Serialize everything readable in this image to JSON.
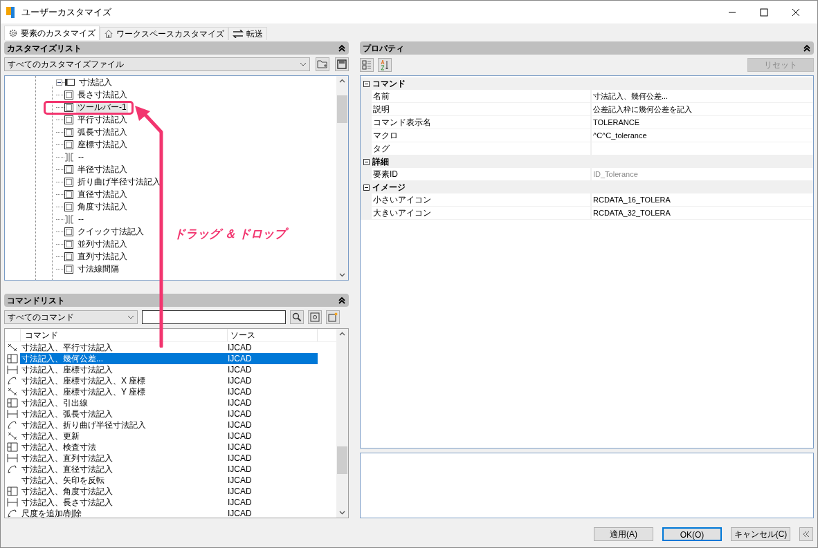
{
  "window": {
    "title": "ユーザーカスタマイズ"
  },
  "tabs": [
    {
      "label": "要素のカスタマイズ",
      "selected": true
    },
    {
      "label": "ワークスペースカスタマイズ",
      "selected": false
    },
    {
      "label": "転送",
      "selected": false
    }
  ],
  "customize_list": {
    "title": "カスタマイズリスト",
    "file_select": "すべてのカスタマイズファイル",
    "tree": [
      {
        "label": "寸法記入",
        "kind": "toolbar",
        "expanded": true,
        "children": [
          {
            "label": "長さ寸法記入",
            "kind": "command",
            "selected": false
          },
          {
            "label": "ツールバー-1",
            "kind": "command",
            "selected": true
          },
          {
            "label": "平行寸法記入",
            "kind": "command",
            "selected": false
          },
          {
            "label": "弧長寸法記入",
            "kind": "command",
            "selected": false
          },
          {
            "label": "座標寸法記入",
            "kind": "command",
            "selected": false
          },
          {
            "label": "--",
            "kind": "separator",
            "selected": false
          },
          {
            "label": "半径寸法記入",
            "kind": "command",
            "selected": false
          },
          {
            "label": "折り曲げ半径寸法記入",
            "kind": "command",
            "selected": false
          },
          {
            "label": "直径寸法記入",
            "kind": "command",
            "selected": false
          },
          {
            "label": "角度寸法記入",
            "kind": "command",
            "selected": false
          },
          {
            "label": "--",
            "kind": "separator",
            "selected": false
          },
          {
            "label": "クイック寸法記入",
            "kind": "command",
            "selected": false
          },
          {
            "label": "並列寸法記入",
            "kind": "command",
            "selected": false
          },
          {
            "label": "直列寸法記入",
            "kind": "command",
            "selected": false
          },
          {
            "label": "寸法線間隔",
            "kind": "command",
            "selected": false
          }
        ]
      }
    ]
  },
  "command_list": {
    "title": "コマンドリスト",
    "filter": "すべてのコマンド",
    "columns": [
      "コマンド",
      "ソース"
    ],
    "rows": [
      {
        "command": "寸法記入、平行寸法記入",
        "source": "IJCAD",
        "icon": true,
        "selected": false
      },
      {
        "command": "寸法記入、幾何公差...",
        "source": "IJCAD",
        "icon": true,
        "selected": true
      },
      {
        "command": "寸法記入、座標寸法記入",
        "source": "IJCAD",
        "icon": true,
        "selected": false
      },
      {
        "command": "寸法記入、座標寸法記入、X 座標",
        "source": "IJCAD",
        "icon": true,
        "selected": false
      },
      {
        "command": "寸法記入、座標寸法記入、Y 座標",
        "source": "IJCAD",
        "icon": true,
        "selected": false
      },
      {
        "command": "寸法記入、引出線",
        "source": "IJCAD",
        "icon": true,
        "selected": false
      },
      {
        "command": "寸法記入、弧長寸法記入",
        "source": "IJCAD",
        "icon": true,
        "selected": false
      },
      {
        "command": "寸法記入、折り曲げ半径寸法記入",
        "source": "IJCAD",
        "icon": true,
        "selected": false
      },
      {
        "command": "寸法記入、更新",
        "source": "IJCAD",
        "icon": true,
        "selected": false
      },
      {
        "command": "寸法記入、検査寸法",
        "source": "IJCAD",
        "icon": true,
        "selected": false
      },
      {
        "command": "寸法記入、直列寸法記入",
        "source": "IJCAD",
        "icon": true,
        "selected": false
      },
      {
        "command": "寸法記入、直径寸法記入",
        "source": "IJCAD",
        "icon": true,
        "selected": false
      },
      {
        "command": "寸法記入、矢印を反転",
        "source": "IJCAD",
        "icon": false,
        "selected": false
      },
      {
        "command": "寸法記入、角度寸法記入",
        "source": "IJCAD",
        "icon": true,
        "selected": false
      },
      {
        "command": "寸法記入、長さ寸法記入",
        "source": "IJCAD",
        "icon": true,
        "selected": false
      },
      {
        "command": "尺度を追加/削除",
        "source": "IJCAD",
        "icon": true,
        "selected": false
      }
    ]
  },
  "properties": {
    "title": "プロパティ",
    "reset": "リセット",
    "groups": [
      {
        "name": "コマンド",
        "expanded": true,
        "rows": [
          {
            "label": "名前",
            "value": "寸法記入、幾何公差...",
            "disabled": false
          },
          {
            "label": "説明",
            "value": "公差記入枠に幾何公差を記入",
            "disabled": false
          },
          {
            "label": "コマンド表示名",
            "value": "TOLERANCE",
            "disabled": false
          },
          {
            "label": "マクロ",
            "value": "^C^C_tolerance",
            "disabled": false
          },
          {
            "label": "タグ",
            "disabled": false
          }
        ]
      },
      {
        "name": "詳細",
        "expanded": true,
        "rows": [
          {
            "label": "要素ID",
            "value": "ID_Tolerance",
            "disabled": true
          }
        ]
      },
      {
        "name": "イメージ",
        "expanded": true,
        "rows": [
          {
            "label": "小さいアイコン",
            "value": "RCDATA_16_TOLERA",
            "disabled": false
          },
          {
            "label": "大きいアイコン",
            "value": "RCDATA_32_TOLERA",
            "disabled": false
          }
        ]
      }
    ]
  },
  "annotation": {
    "text": "ドラッグ ＆ ドロップ"
  },
  "buttons": [
    {
      "label": "適用(A)",
      "default": false
    },
    {
      "label": "OK(O)",
      "default": true
    },
    {
      "label": "キャンセル(C)",
      "default": false
    }
  ]
}
